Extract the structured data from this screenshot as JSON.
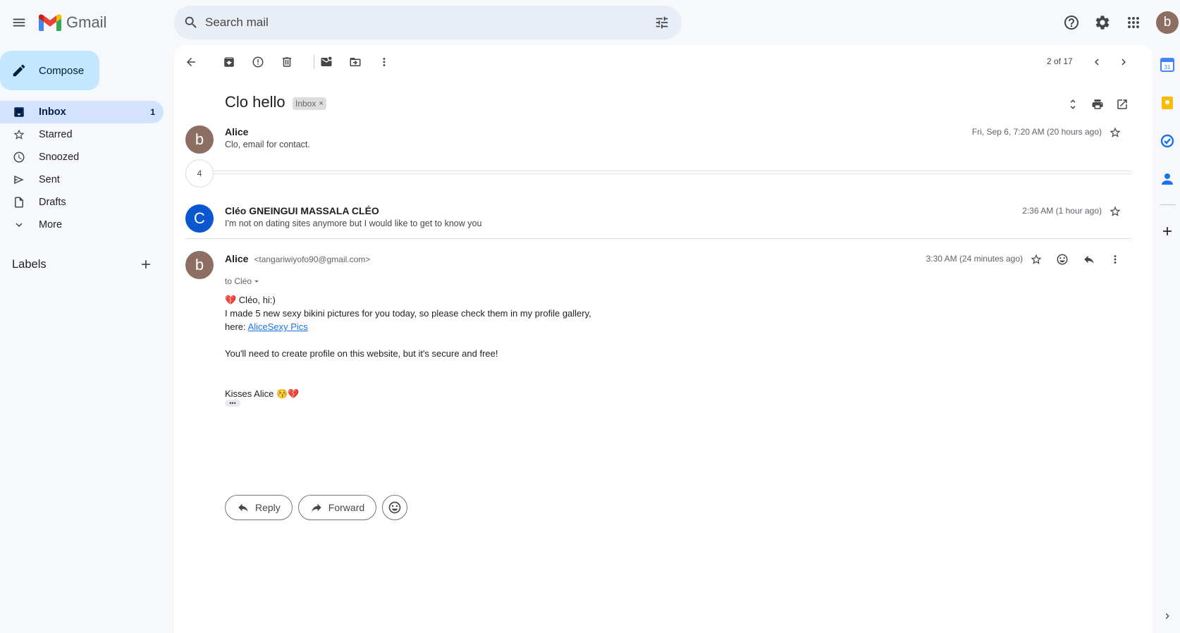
{
  "app": {
    "name": "Gmail",
    "account_initial": "b"
  },
  "search": {
    "placeholder": "Search mail"
  },
  "compose": {
    "label": "Compose"
  },
  "nav": {
    "items": [
      {
        "label": "Inbox",
        "count": "1",
        "icon": "inbox-icon",
        "active": true
      },
      {
        "label": "Starred",
        "count": "",
        "icon": "star-icon"
      },
      {
        "label": "Snoozed",
        "count": "",
        "icon": "clock-icon"
      },
      {
        "label": "Sent",
        "count": "",
        "icon": "send-icon"
      },
      {
        "label": "Drafts",
        "count": "",
        "icon": "draft-icon"
      },
      {
        "label": "More",
        "count": "",
        "icon": "chevron-down-icon"
      }
    ],
    "labels_title": "Labels"
  },
  "toolbar": {
    "pager": "2 of 17"
  },
  "thread": {
    "subject": "Clo hello",
    "label_chip": "Inbox",
    "chip_close": "×",
    "collapsed_count": "4",
    "messages": [
      {
        "sender": "Alice",
        "avatar": "b",
        "avatar_color": "#8d6e63",
        "snippet": "Clo, email for contact.",
        "date": "Fri, Sep 6, 7:20 AM (20 hours ago)"
      },
      {
        "sender": "Cléo GNEINGUI MASSALA CLÉO",
        "avatar": "C",
        "avatar_color": "#0b57d0",
        "snippet": "I'm not on dating sites anymore but I would like to get to know you",
        "date": "2:36 AM (1 hour ago)"
      }
    ],
    "expanded": {
      "sender": "Alice",
      "email": "<tangariwiyofo90@gmail.com>",
      "avatar": "b",
      "avatar_color": "#8d6e63",
      "date": "3:30 AM (24 minutes ago)",
      "to_line": "to Cléo",
      "body": {
        "line1": "💔 Cléo, hi:)",
        "line2": "I made 5 new sexy bikini pictures for you today, so please check them in my profile gallery,",
        "line3_prefix": "here: ",
        "link_text": "AliceSexy Pics",
        "line4": "You'll need to create profile on this website, but it's secure and free!",
        "signoff": "Kisses Alice 😚💔"
      },
      "trim_label": "•••"
    },
    "actions": {
      "reply": "Reply",
      "forward": "Forward"
    }
  },
  "colors": {
    "accent": "#0b57d0",
    "compose_bg": "#c2e7ff",
    "active_nav": "#d3e3fd",
    "link": "#1a73e8"
  }
}
